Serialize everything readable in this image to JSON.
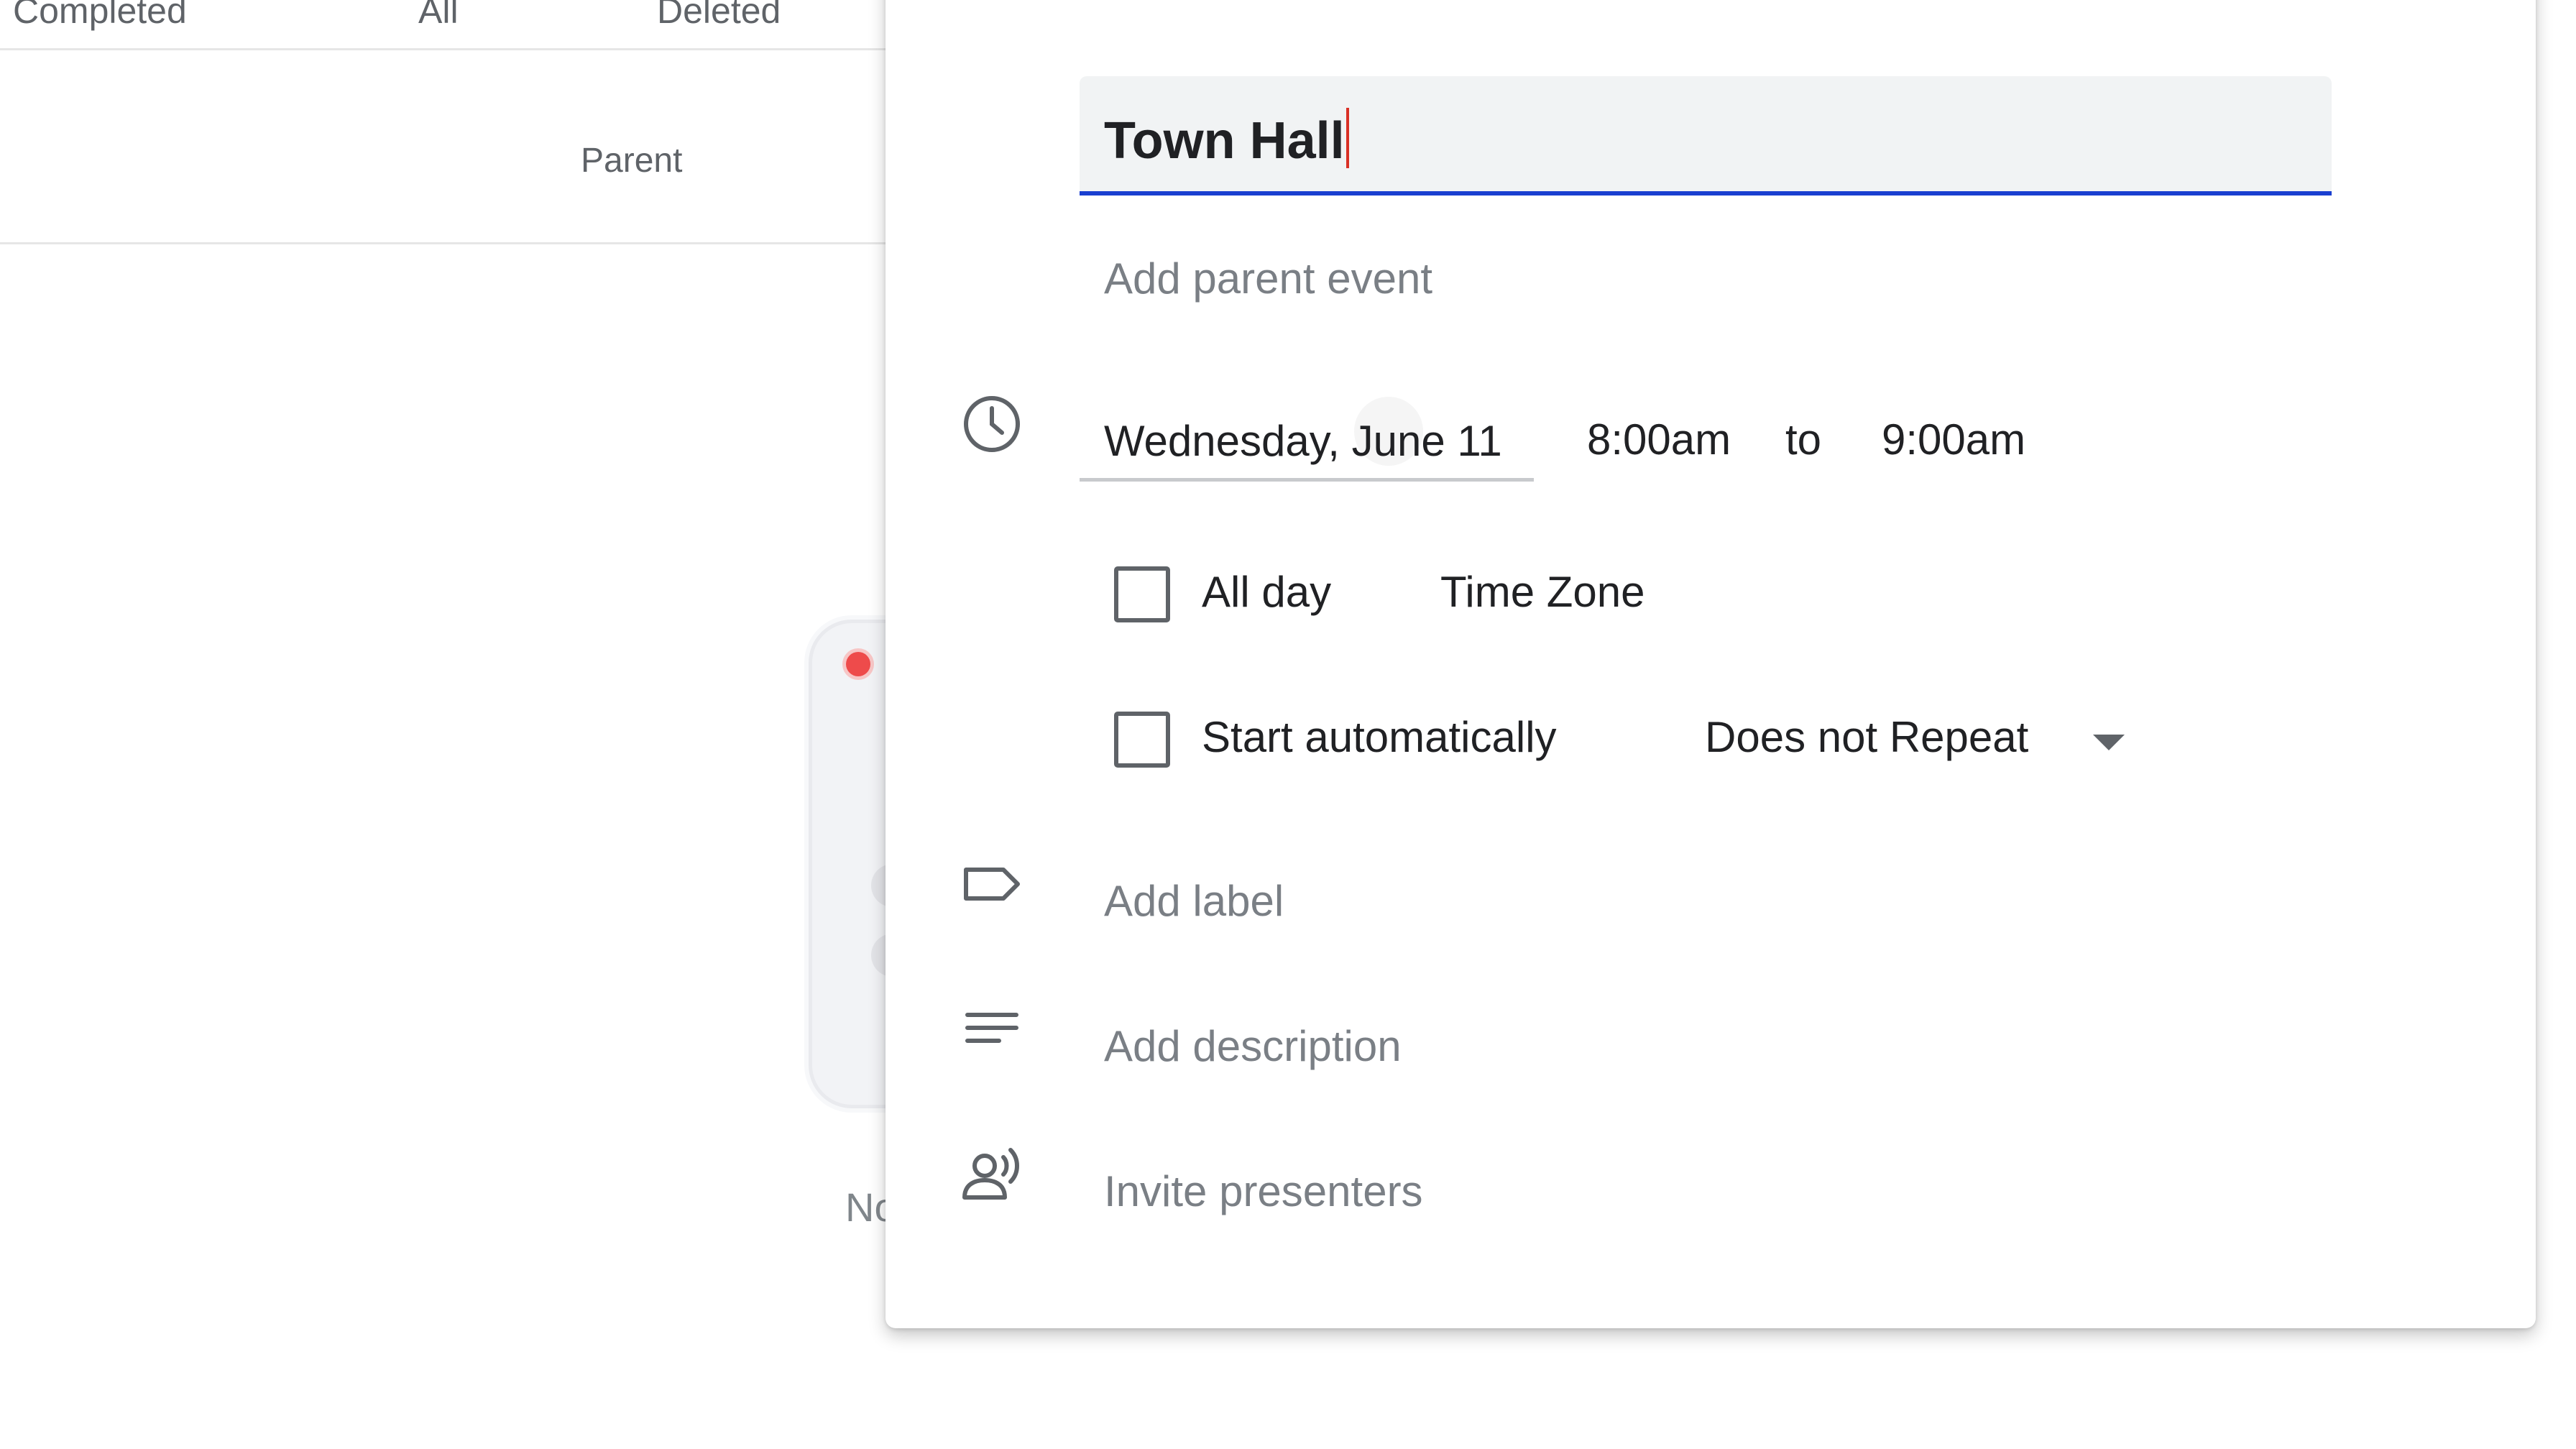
{
  "background": {
    "tabs": [
      "Completed",
      "All",
      "Deleted"
    ],
    "column_header": "Parent",
    "empty_state_text": "No"
  },
  "event_editor": {
    "title_value": "Town Hall",
    "parent_event_placeholder": "Add parent event",
    "date": "Wednesday, June 11",
    "start_time": "8:00am",
    "to_label": "to",
    "end_time": "9:00am",
    "all_day_label": "All day",
    "all_day_checked": false,
    "time_zone_label": "Time Zone",
    "start_automatically_label": "Start automatically",
    "start_automatically_checked": false,
    "repeat_value": "Does not Repeat",
    "add_label_placeholder": "Add label",
    "add_description_placeholder": "Add description",
    "invite_presenters_placeholder": "Invite presenters"
  },
  "icons": {
    "time": "clock-icon",
    "label": "label-tag-icon",
    "description": "description-lines-icon",
    "presenters": "presenter-voice-icon",
    "repeat_dropdown": "dropdown-arrow-icon"
  },
  "colors": {
    "accent": "#1a3fd0",
    "caret": "#d93025",
    "field_background": "#f1f3f4",
    "empty_state_dot": "#ee4b4b"
  }
}
